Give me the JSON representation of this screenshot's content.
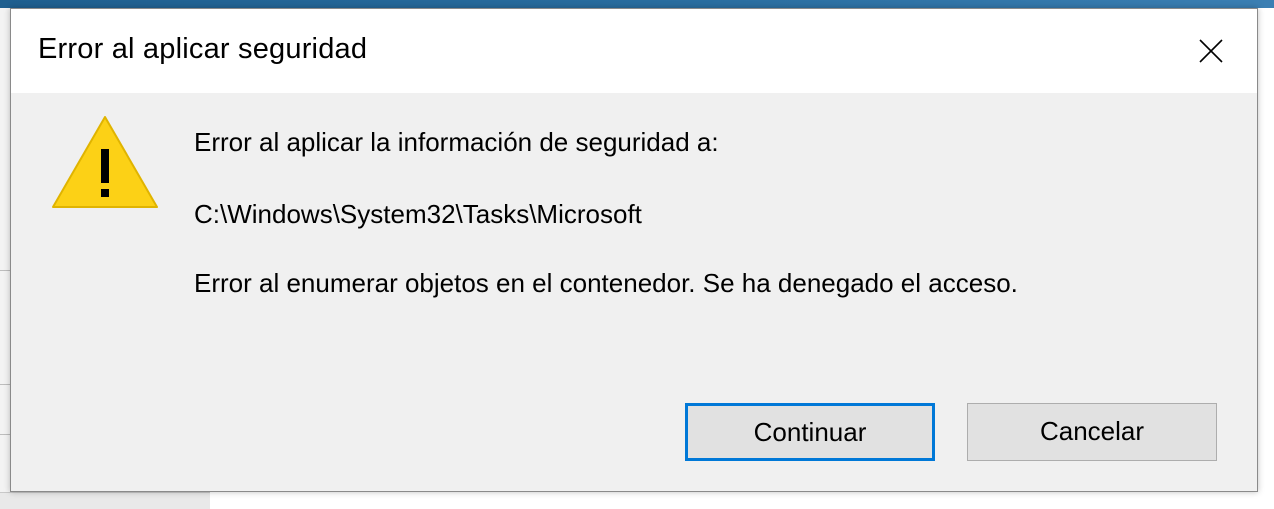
{
  "dialog": {
    "title": "Error al aplicar seguridad",
    "icon": "warning-icon",
    "messages": {
      "line1": "Error al aplicar la información de seguridad a:",
      "path": "C:\\Windows\\System32\\Tasks\\Microsoft",
      "line3": "Error al enumerar objetos en el contenedor. Se ha denegado el acceso."
    },
    "buttons": {
      "continue_label": "Continuar",
      "cancel_label": "Cancelar"
    }
  },
  "colors": {
    "title_background": "#ffffff",
    "body_background": "#f0f0f0",
    "focus_border": "#0078d7",
    "warning_fill": "#fcd116",
    "button_background": "#e1e1e1"
  }
}
